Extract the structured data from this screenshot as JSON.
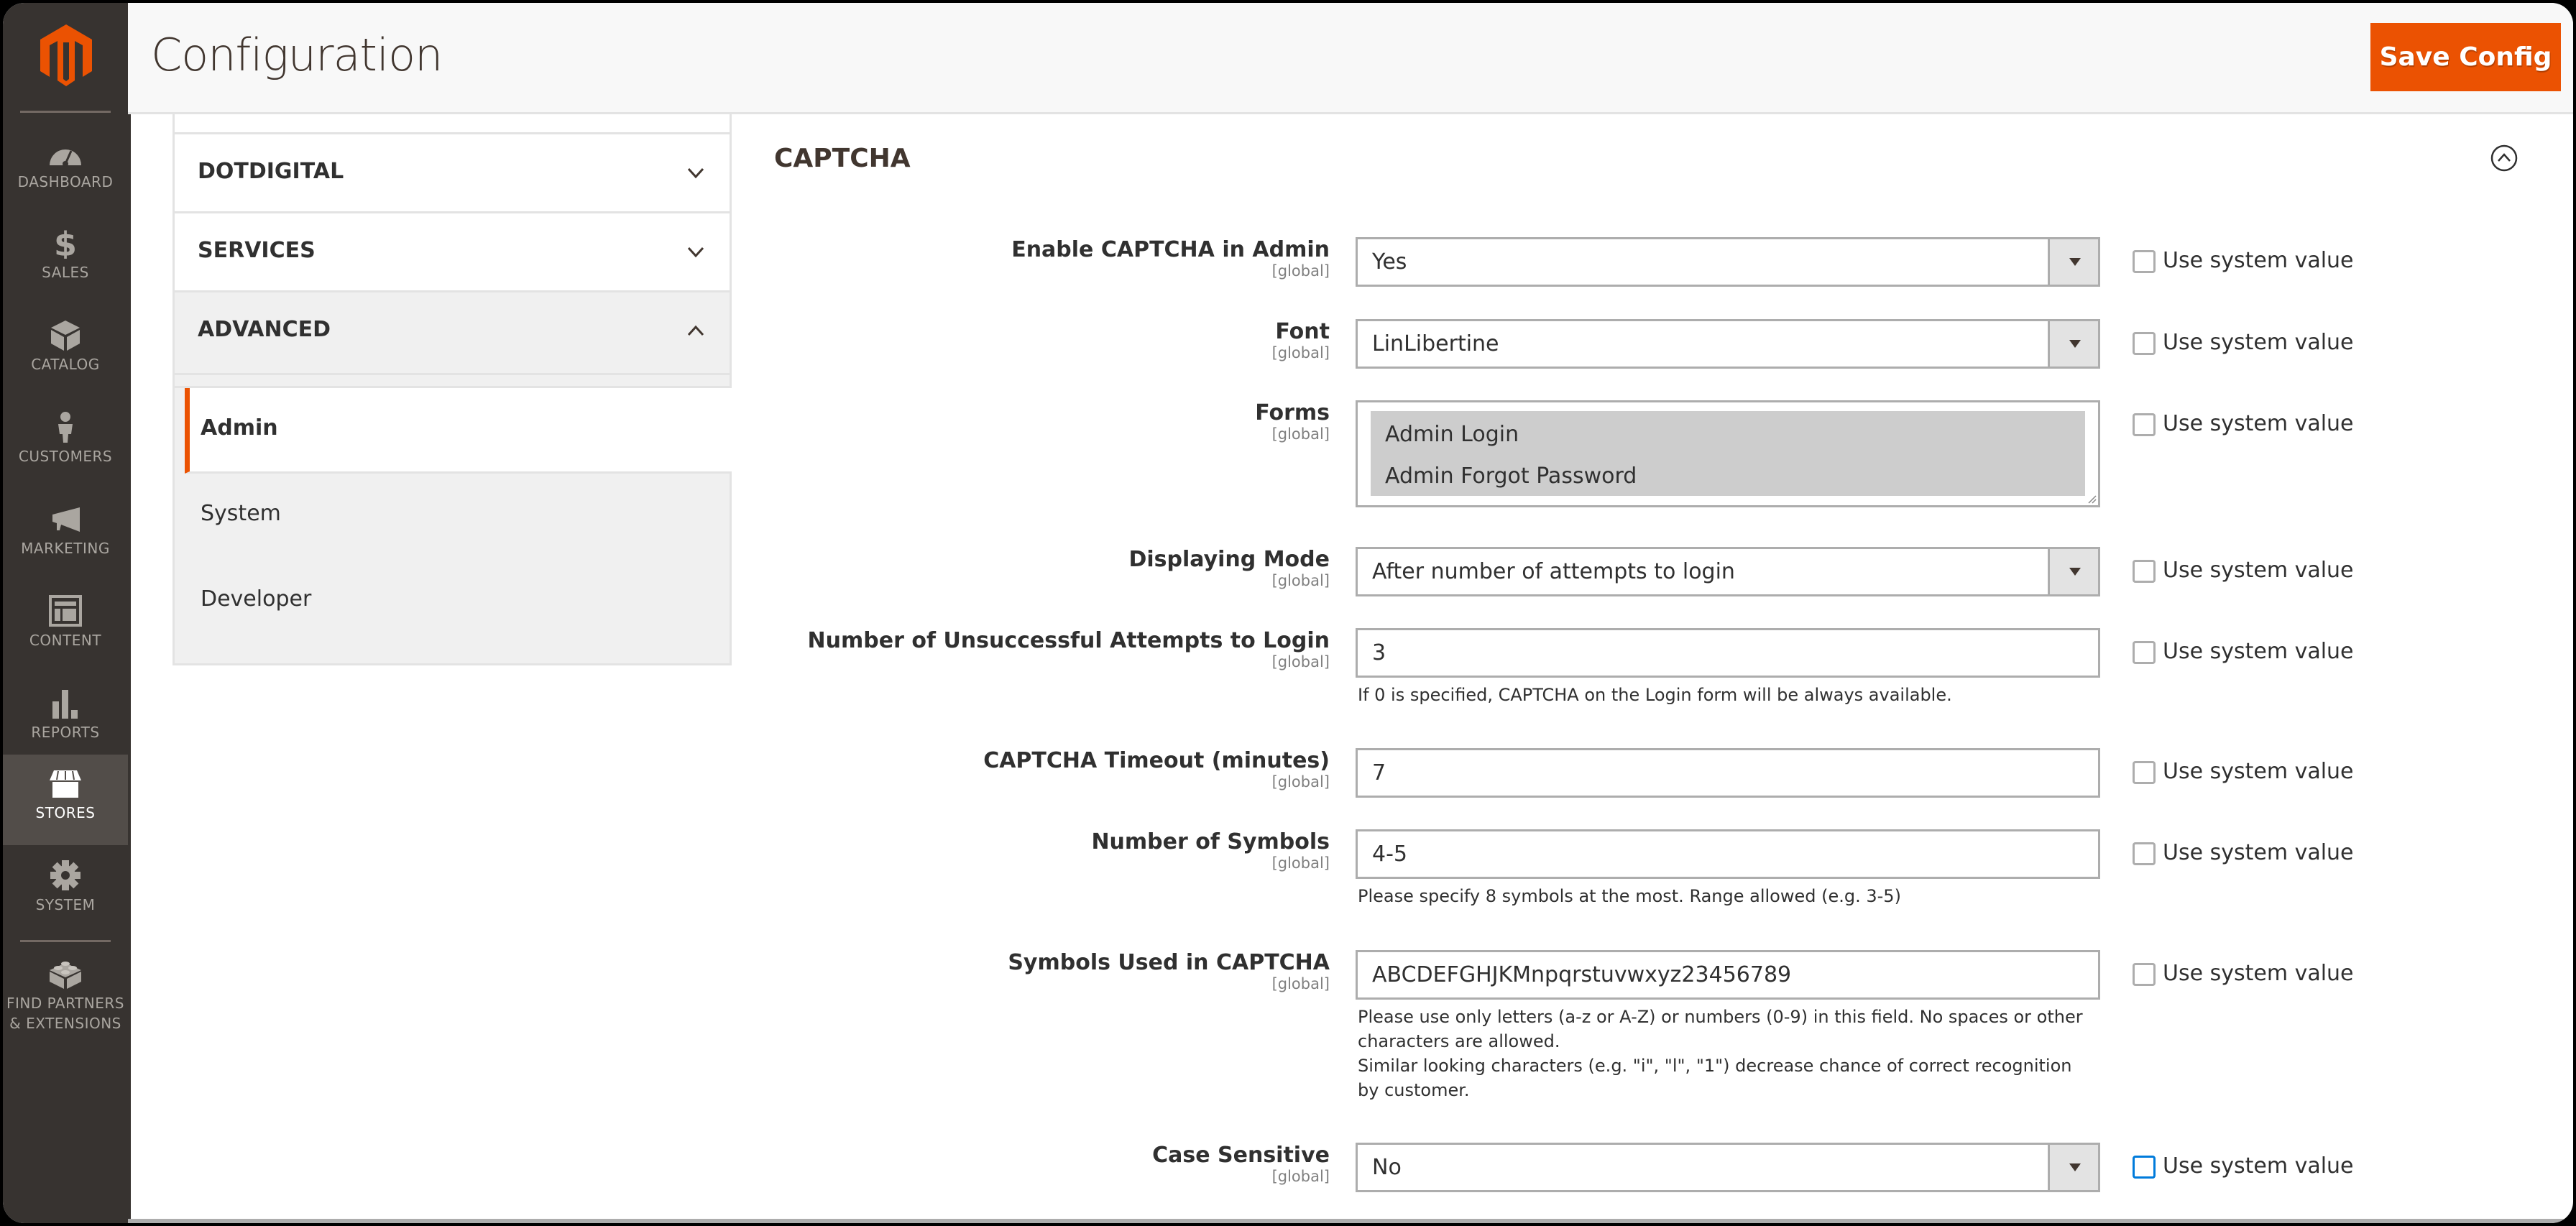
{
  "colors": {
    "brand_orange": "#eb5202",
    "nav_bg": "#373330",
    "nav_active_bg": "#524d49",
    "focus_blue": "#007bdb"
  },
  "nav": {
    "logo": "magento-logo-icon",
    "items": [
      {
        "label": "DASHBOARD",
        "icon": "dashboard-gauge-icon"
      },
      {
        "label": "SALES",
        "icon": "dollar-icon"
      },
      {
        "label": "CATALOG",
        "icon": "box-icon"
      },
      {
        "label": "CUSTOMERS",
        "icon": "person-icon"
      },
      {
        "label": "MARKETING",
        "icon": "megaphone-icon"
      },
      {
        "label": "CONTENT",
        "icon": "layout-icon"
      },
      {
        "label": "REPORTS",
        "icon": "bar-chart-icon"
      },
      {
        "label": "STORES",
        "icon": "storefront-icon",
        "active": true
      },
      {
        "label": "SYSTEM",
        "icon": "gear-icon"
      },
      {
        "label_line1": "FIND PARTNERS",
        "label_line2": "& EXTENSIONS",
        "icon": "lego-brick-icon"
      }
    ]
  },
  "header": {
    "title": "Configuration",
    "save_label": "Save Config"
  },
  "config_nav": {
    "sections": [
      {
        "label": "DOTDIGITAL",
        "expanded": false
      },
      {
        "label": "SERVICES",
        "expanded": false
      },
      {
        "label": "ADVANCED",
        "expanded": true
      }
    ],
    "items": [
      {
        "label": "Admin",
        "active": true
      },
      {
        "label": "System",
        "active": false
      },
      {
        "label": "Developer",
        "active": false
      }
    ]
  },
  "section": {
    "title": "CAPTCHA",
    "use_system_value_label": "Use system value",
    "scope_label": "[global]",
    "fields": [
      {
        "label": "Enable CAPTCHA in Admin",
        "type": "select",
        "value": "Yes"
      },
      {
        "label": "Font",
        "type": "select",
        "value": "LinLibertine"
      },
      {
        "label": "Forms",
        "type": "multiselect",
        "options": [
          "Admin Login",
          "Admin Forgot Password"
        ],
        "selected": [
          "Admin Login",
          "Admin Forgot Password"
        ]
      },
      {
        "label": "Displaying Mode",
        "type": "select",
        "value": "After number of attempts to login"
      },
      {
        "label": "Number of Unsuccessful Attempts to Login",
        "type": "text",
        "value": "3",
        "note": "If 0 is specified, CAPTCHA on the Login form will be always available."
      },
      {
        "label": "CAPTCHA Timeout (minutes)",
        "type": "text",
        "value": "7"
      },
      {
        "label": "Number of Symbols",
        "type": "text",
        "value": "4-5",
        "note": "Please specify 8 symbols at the most. Range allowed (e.g. 3-5)"
      },
      {
        "label": "Symbols Used in CAPTCHA",
        "type": "text",
        "value": "ABCDEFGHJKMnpqrstuvwxyz23456789",
        "note_line1": "Please use only letters (a-z or A-Z) or numbers (0-9) in this field. No spaces or other characters are allowed.",
        "note_line2": "Similar looking characters (e.g. \"i\", \"l\", \"1\") decrease chance of correct recognition by customer."
      },
      {
        "label": "Case Sensitive",
        "type": "select",
        "value": "No",
        "use_system_focused": true
      }
    ]
  }
}
